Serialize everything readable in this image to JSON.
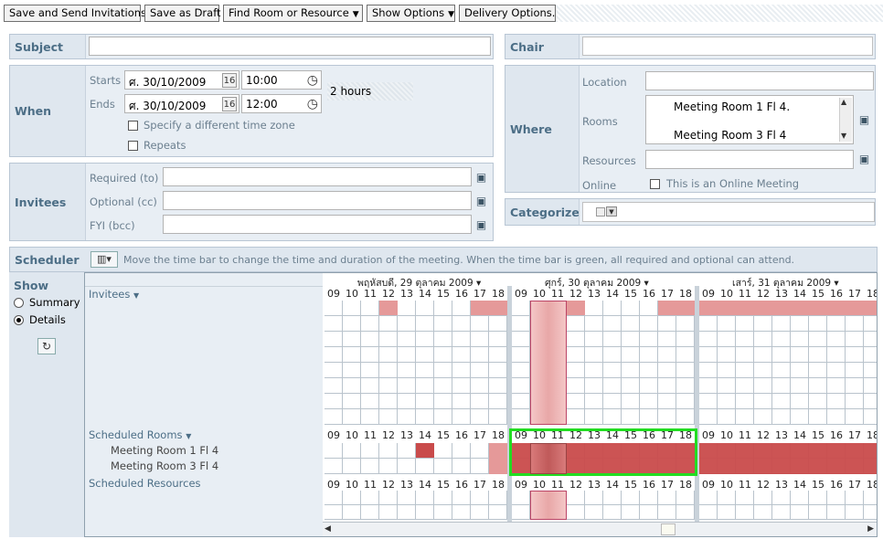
{
  "toolbar": {
    "save_send": "Save and Send Invitations",
    "save_draft": "Save as Draft",
    "find_room": "Find Room or Resource",
    "show_options": "Show Options",
    "delivery_options": "Delivery Options..."
  },
  "subject": {
    "label": "Subject",
    "value": ""
  },
  "chair": {
    "label": "Chair",
    "value": ""
  },
  "when": {
    "label": "When",
    "starts_label": "Starts",
    "ends_label": "Ends",
    "start_date": "ศ. 30/10/2009",
    "start_time": "10:00",
    "end_date": "ศ. 30/10/2009",
    "end_time": "12:00",
    "duration": "2 hours",
    "timezone_label": "Specify a different time zone",
    "repeats_label": "Repeats",
    "cal_icon_text": "16"
  },
  "where": {
    "label": "Where",
    "location_label": "Location",
    "rooms_label": "Rooms",
    "rooms": [
      "Meeting Room 1 Fl 4.",
      "Meeting Room 3 Fl 4"
    ],
    "resources_label": "Resources",
    "online_label": "Online",
    "online_checkbox": "This is an Online Meeting"
  },
  "invitees": {
    "label": "Invitees",
    "required": "Required (to)",
    "optional": "Optional (cc)",
    "fyi": "FYI (bcc)"
  },
  "categorize": {
    "label": "Categorize"
  },
  "scheduler": {
    "label": "Scheduler",
    "hint": "Move the time bar to change the time and duration of the meeting.  When the time bar is green, all required and optional can attend.",
    "show_label": "Show",
    "summary": "Summary",
    "details": "Details",
    "invitees_header": "Invitees",
    "scheduled_rooms": "Scheduled Rooms",
    "scheduled_resources": "Scheduled Resources",
    "room_rows": [
      "Meeting Room 1 Fl 4",
      "Meeting Room 3 Fl 4"
    ],
    "days": [
      "พฤหัสบดี, 29 ตุลาคม 2009",
      "ศุกร์, 30 ตุลาคม 2009",
      "เสาร์, 31 ตุลาคม 2009"
    ],
    "hours": [
      "09",
      "10",
      "11",
      "12",
      "13",
      "14",
      "15",
      "16",
      "17",
      "18"
    ]
  },
  "colors": {
    "busy": "#e59999",
    "busy_dark": "#c94b4b",
    "free_frame": "#22dd22",
    "label": "#4c6e86"
  }
}
